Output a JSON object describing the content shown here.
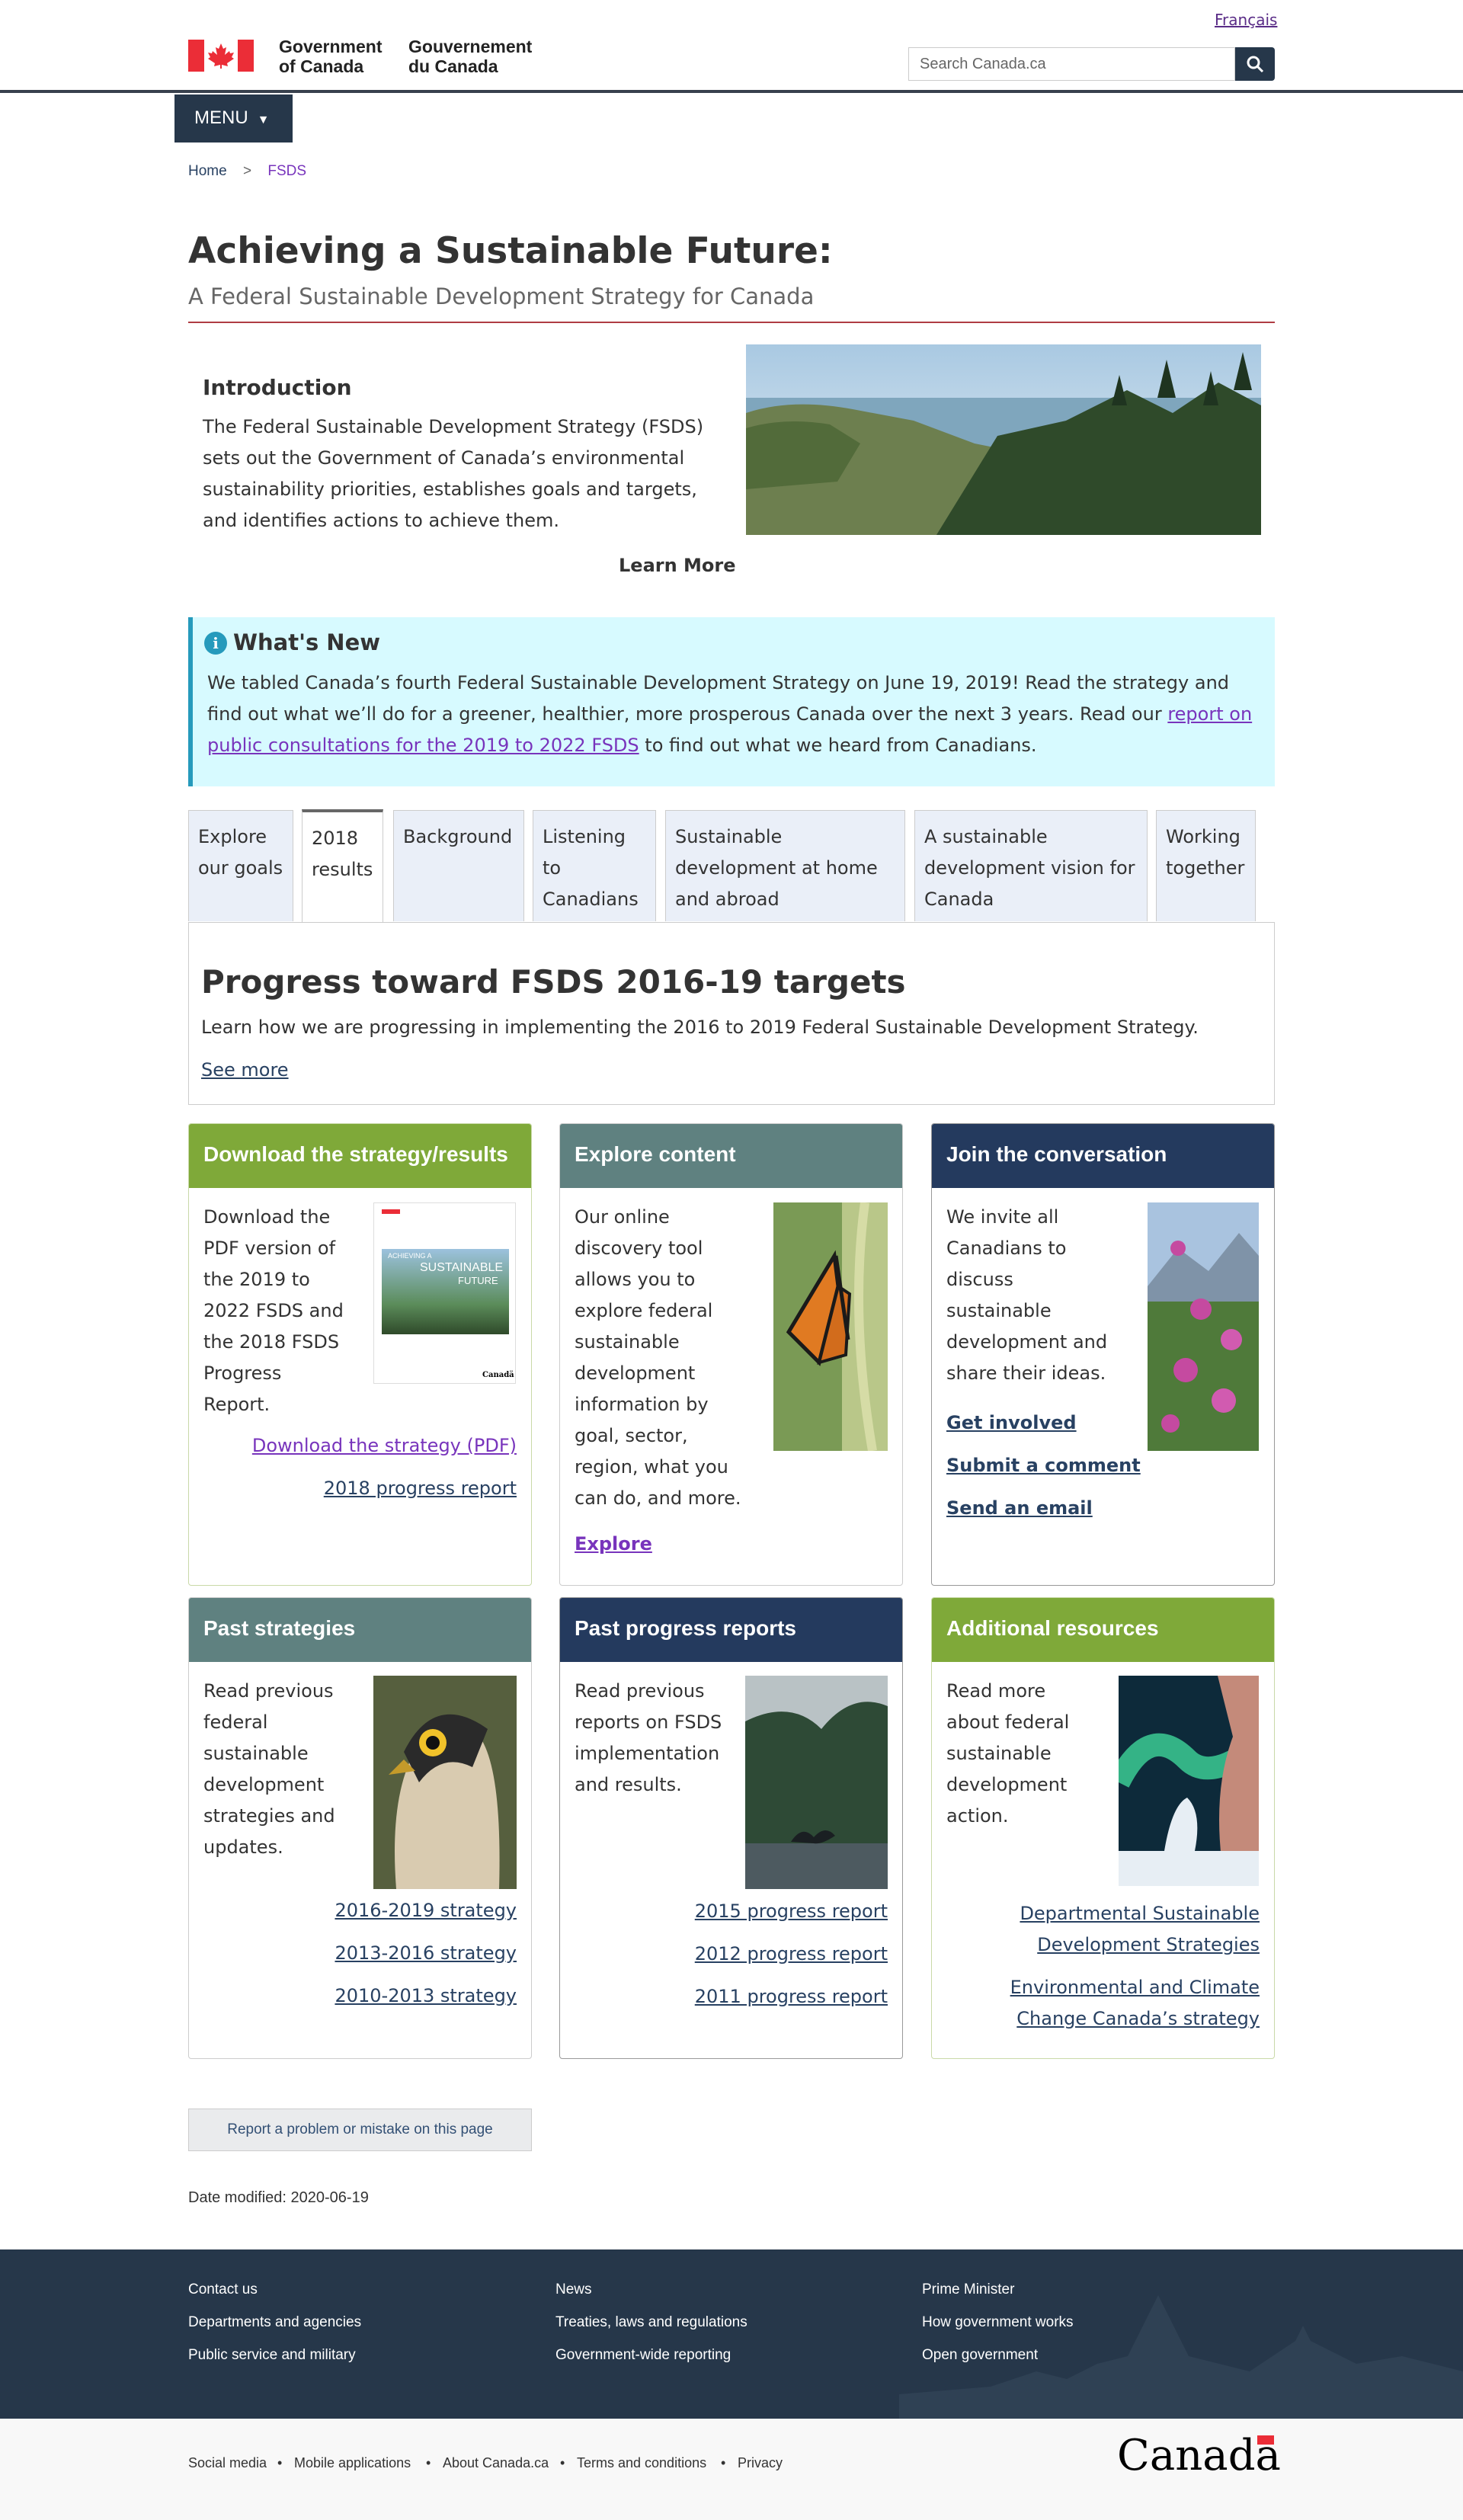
{
  "header": {
    "lang_link": "Français",
    "govt_en_line1": "Government",
    "govt_en_line2": "of Canada",
    "govt_fr_line1": "Gouvernement",
    "govt_fr_line2": "du Canada",
    "search_placeholder": "Search Canada.ca",
    "menu_label": "MENU"
  },
  "breadcrumb": {
    "home": "Home",
    "sep": ">",
    "current": "FSDS"
  },
  "page": {
    "title": "Achieving a Sustainable Future:",
    "subtitle": "A Federal Sustainable Development Strategy for Canada"
  },
  "intro": {
    "heading": "Introduction",
    "text": "The Federal Sustainable Development Strategy (FSDS) sets out the Government of Canada’s environmental sustainability priorities, establishes goals and targets, and identifies actions to achieve them.",
    "learn_more": "Learn More"
  },
  "whats_new": {
    "heading": "What's New",
    "text_before": "We tabled Canada’s fourth Federal Sustainable Development Strategy on June 19, 2019! Read the strategy and find out what we’ll do for a greener, healthier, more prosperous Canada over the next 3 years. Read our ",
    "link": "report on public consultations for the 2019 to 2022 FSDS",
    "text_after": " to find out what we heard from Canadians."
  },
  "tabs": [
    "Explore our goals",
    "2018 results",
    "Background",
    "Listening to Canadians",
    "Sustainable development at home and abroad",
    "A sustainable development vision for Canada",
    "Working together"
  ],
  "active_tab_index": 1,
  "tab_panel": {
    "heading": "Progress toward FSDS 2016-19 targets",
    "text": "Learn how we are progressing in implementing the 2016 to 2019 Federal Sustainable Development Strategy.",
    "link": "See more"
  },
  "cards": {
    "download": {
      "title": "Download the strategy/results",
      "text": "Download the PDF version of the 2019 to 2022 FSDS and the 2018 FSDS Progress Report.",
      "links": [
        "Download the strategy (PDF)",
        "2018 progress report"
      ],
      "color": "#7fa939"
    },
    "explore": {
      "title": "Explore content",
      "text": "Our online discovery tool allows you to explore federal sustainable development information by goal, sector, region, what you can do, and more.",
      "links": [
        "Explore"
      ],
      "color": "#5f8180"
    },
    "join": {
      "title": "Join the conversation",
      "text": "We invite all Canadians to discuss sustainable development and share their ideas.",
      "links": [
        "Get involved",
        "Submit a comment",
        "Send an email"
      ],
      "color": "#243a5e"
    },
    "past_strategies": {
      "title": "Past strategies",
      "text": "Read previous federal sustainable development strategies and updates.",
      "links": [
        "2016-2019 strategy",
        "2013-2016 strategy",
        "2010-2013 strategy"
      ],
      "color": "#5f8180"
    },
    "past_reports": {
      "title": "Past progress reports",
      "text": "Read previous reports on FSDS implementation and results.",
      "links": [
        "2015 progress report",
        "2012 progress report",
        "2011 progress report"
      ],
      "color": "#243a5e"
    },
    "additional": {
      "title": "Additional resources",
      "text": "Read more about federal sustainable development action.",
      "links": [
        "Departmental Sustainable Development Strategies",
        "Environmental and Climate Change Canada’s strategy"
      ],
      "color": "#7fa939"
    }
  },
  "pdf_cover": {
    "line1": "ACHIEVING A",
    "line2": "SUSTAINABLE",
    "line3": "FUTURE",
    "brand": "Canadä"
  },
  "report_button": "Report a problem or mistake on this page",
  "date_modified": "Date modified: 2020-06-19",
  "footer_links": [
    [
      "Contact us",
      "Departments and agencies",
      "Public service and military"
    ],
    [
      "News",
      "Treaties, laws and regulations",
      "Government-wide reporting"
    ],
    [
      "Prime Minister",
      "How government works",
      "Open government"
    ]
  ],
  "sub_footer": [
    "Social media",
    "Mobile applications",
    "About Canada.ca",
    "Terms and conditions",
    "Privacy"
  ],
  "wordmark": "Canadä",
  "colors": {
    "navy": "#26374a",
    "accent_red": "#af3c43",
    "link": "#284162",
    "visited": "#7834bc",
    "info_bg": "#d7faff"
  }
}
